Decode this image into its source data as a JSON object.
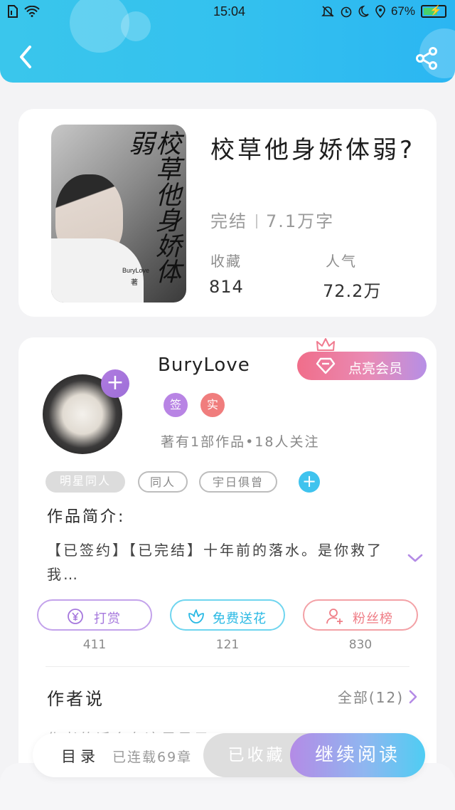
{
  "status_bar": {
    "time": "15:04",
    "battery": "67%"
  },
  "colors": {
    "accent": "#34c1ee",
    "purple": "#a678dd",
    "pink": "#f06e8a"
  },
  "book": {
    "title": "校草他身娇体弱?",
    "cover_title": "校草他身娇体弱",
    "cover_author": "BuryLove",
    "cover_zhu": "著",
    "status": "完结",
    "word_count": "7.1万字",
    "favorites_label": "收藏",
    "favorites_value": "814",
    "popularity_label": "人气",
    "popularity_value": "72.2万"
  },
  "author": {
    "name": "BuryLove",
    "badge_sign": "签",
    "badge_real": "实",
    "works": "著有1部作品•18人关注",
    "vip_label": "点亮会员"
  },
  "tags": [
    "明星同人",
    "同人",
    "宇日俱曾"
  ],
  "intro": {
    "title": "作品简介:",
    "text": "【已签约】【已完结】十年前的落水。是你救了我…"
  },
  "actions": [
    {
      "label": "打赏",
      "count": "411",
      "icon": "yen-icon"
    },
    {
      "label": "免费送花",
      "count": "121",
      "icon": "flower-icon"
    },
    {
      "label": "粉丝榜",
      "count": "830",
      "icon": "fans-icon"
    }
  ],
  "author_says": {
    "title": "作者说",
    "all": "全部(12)",
    "preview": "作者的话会在这里显示……"
  },
  "bottom_bar": {
    "toc": "目录",
    "serial": "已连载69章",
    "collected": "已收藏",
    "continue": "继续阅读"
  }
}
